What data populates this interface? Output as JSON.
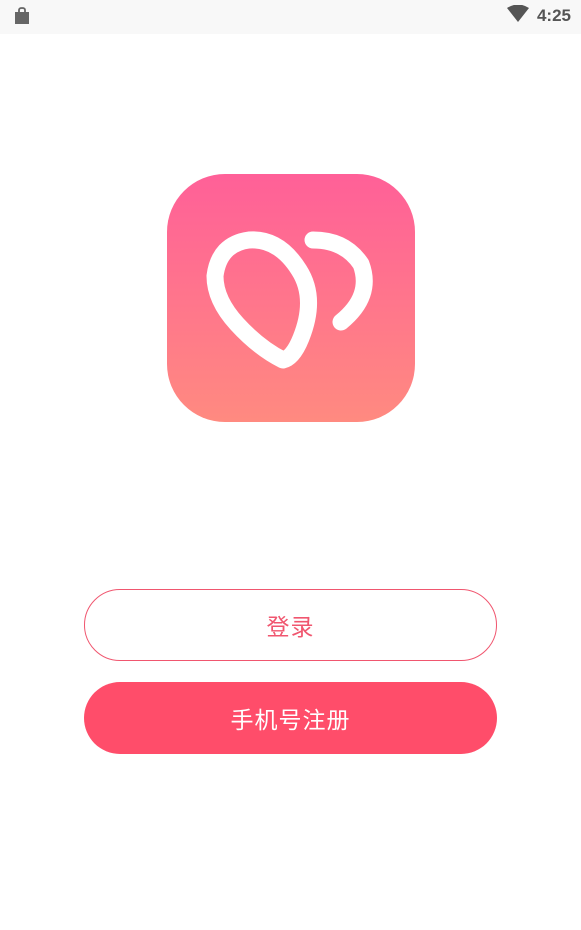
{
  "status_bar": {
    "time": "4:25",
    "left_icon": "shopping-bag-icon",
    "right_icon": "wifi-icon"
  },
  "app": {
    "logo_icon": "heart-drop-logo-icon",
    "brand_gradient": [
      "#ff6098",
      "#ff8a80"
    ],
    "accent_color": "#ff4d6a"
  },
  "actions": {
    "login_label": "登录",
    "register_label": "手机号注册"
  }
}
